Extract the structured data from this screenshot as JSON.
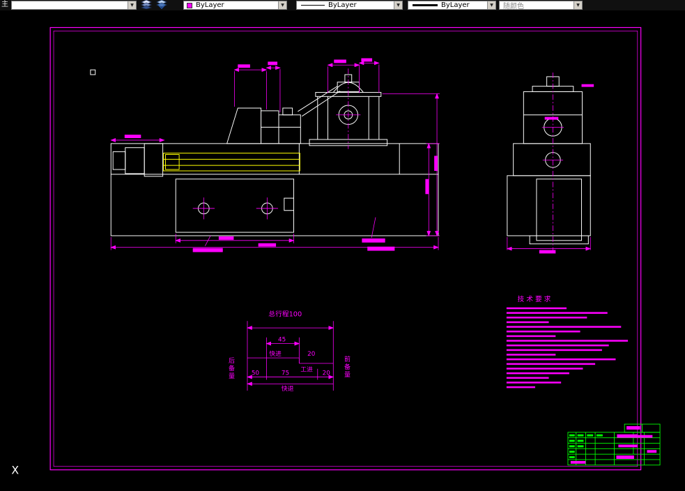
{
  "toolbar": {
    "layer_label": "主",
    "color_dropdown": {
      "value": "ByLayer",
      "swatch": "#FF00FF"
    },
    "linetype_dropdown": {
      "value": "ByLayer"
    },
    "lineweight_dropdown": {
      "value": "ByLayer"
    },
    "plot_style_dropdown": {
      "value": "随颜色",
      "disabled": true
    },
    "arrow_glyph": "▼"
  },
  "canvas": {
    "ucs_label": "X",
    "colors": {
      "magenta": "#FF00FF",
      "white": "#FFFFFF",
      "yellow": "#FFFF00",
      "green": "#00FF00",
      "black": "#000000"
    }
  },
  "cycle_diagram": {
    "title": "总行程100",
    "dim_45": "45",
    "dim_20_top": "20",
    "dim_50": "50",
    "dim_75": "75",
    "dim_20_bottom": "20",
    "label_fast_advance": "快进",
    "label_work_feed": "工进",
    "label_fast_return": "快退",
    "label_rear_reserve": "后备量",
    "label_front_reserve": "前备量"
  },
  "tech_requirements": {
    "title": "技术要求",
    "line_widths": [
      88,
      148,
      118,
      62,
      168,
      108,
      72,
      178,
      150,
      140,
      72,
      160,
      130,
      112,
      92,
      62,
      80,
      42
    ]
  }
}
